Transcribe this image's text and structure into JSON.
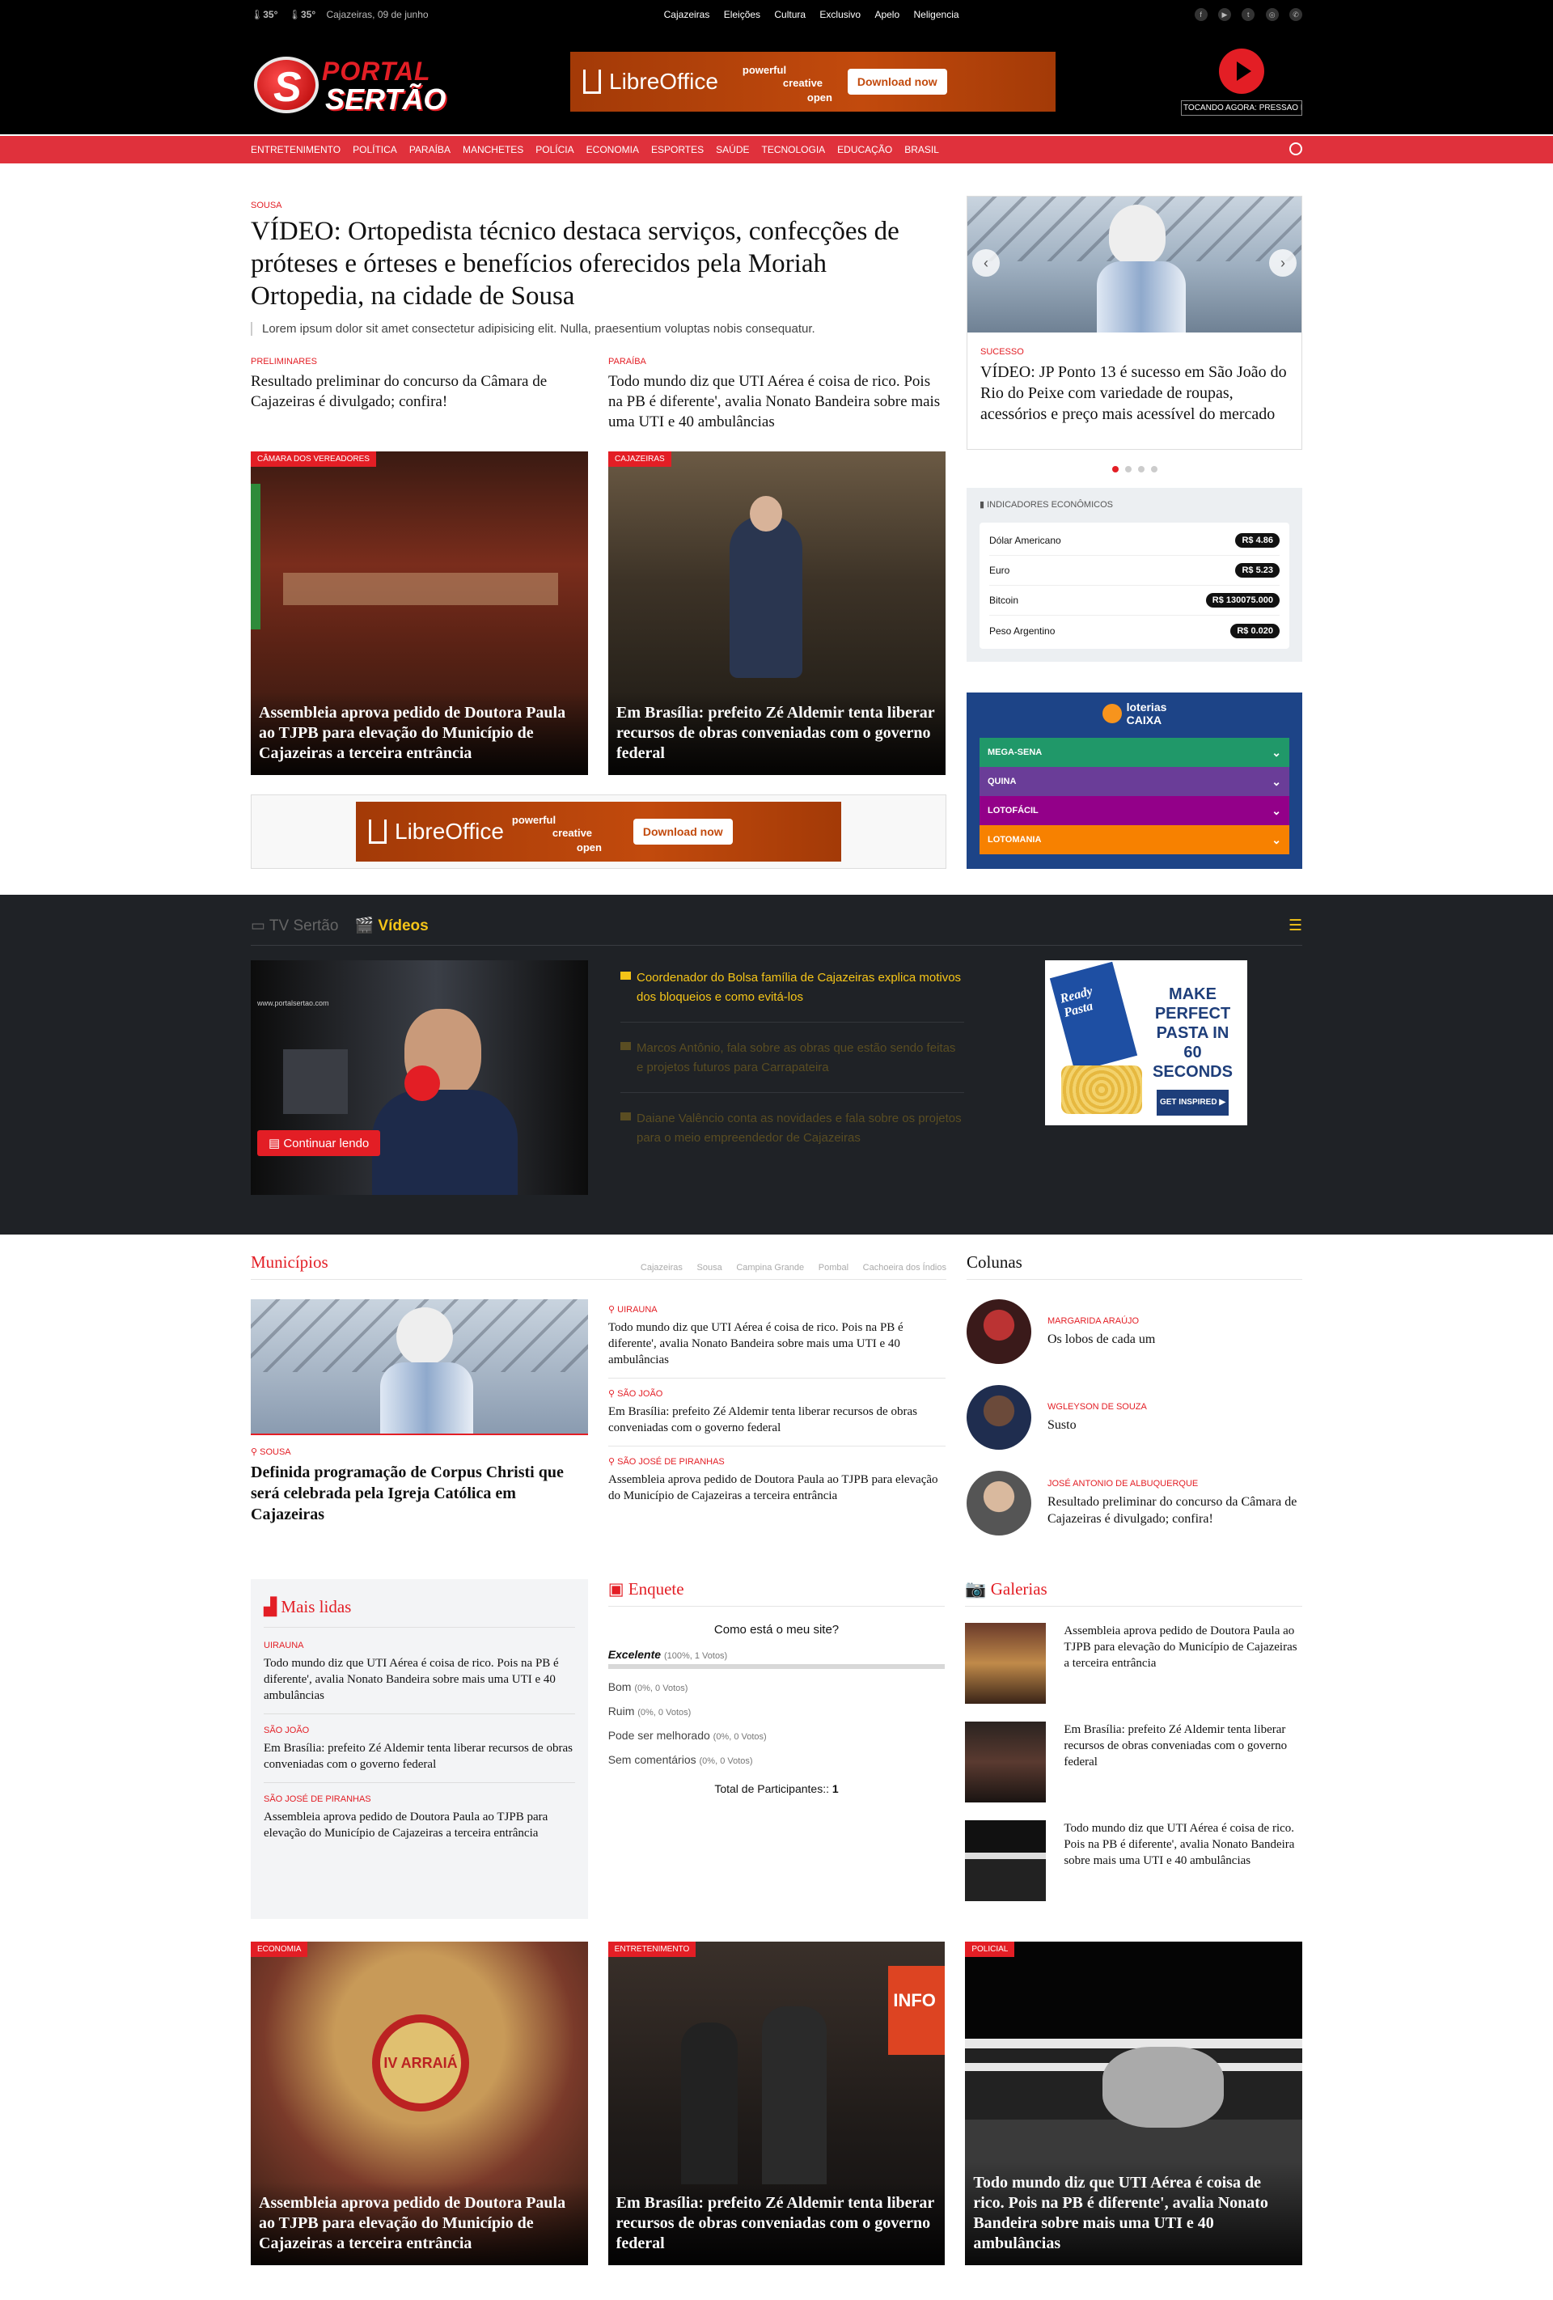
{
  "topbar": {
    "weather1": "35°",
    "weather2": "35°",
    "date": "Cajazeiras, 09 de junho",
    "links": [
      "Cajazeiras",
      "Eleições",
      "Cultura",
      "Exclusivo",
      "Apelo",
      "Neligencia"
    ],
    "social": [
      "facebook-icon",
      "youtube-icon",
      "twitter-icon",
      "instagram-icon",
      "whatsapp-icon"
    ]
  },
  "header": {
    "logo_top": "PORTAL",
    "logo_bottom": "SERTÃO",
    "ad": {
      "brand": "LibreOffice",
      "tag1": "powerful",
      "tag2": "creative",
      "tag3": "open",
      "cta": "Download now"
    },
    "player_now": "TOCANDO AGORA: PRESSAO FO"
  },
  "nav": [
    "ENTRETENIMENTO",
    "POLÍTICA",
    "PARAÍBA",
    "MANCHETES",
    "POLÍCIA",
    "ECONOMIA",
    "ESPORTES",
    "SAÚDE",
    "TECNOLOGIA",
    "EDUCAÇÃO",
    "BRASIL"
  ],
  "lead": {
    "cat": "SOUSA",
    "title": "VÍDEO: Ortopedista técnico destaca serviços, confecções de próteses e órteses e benefícios oferecidos pela Moriah Ortopedia, na cidade de Sousa",
    "excerpt": "Lorem ipsum dolor sit amet consectetur adipisicing elit. Nulla, praesentium voluptas nobis consequatur."
  },
  "sub": [
    {
      "cat": "PRELIMINARES",
      "title": "Resultado preliminar do concurso da Câmara de Cajazeiras é divulgado; confira!"
    },
    {
      "cat": "PARAÍBA",
      "title": "Todo mundo diz que UTI Aérea é coisa de rico. Pois na PB é diferente', avalia Nonato Bandeira sobre mais uma UTI e 40 ambulâncias"
    }
  ],
  "cards": [
    {
      "cat": "CÂMARA DOS VEREADORES",
      "title": "Assembleia aprova pedido de Doutora Paula ao TJPB para elevação do Município de Cajazeiras a terceira entrância"
    },
    {
      "cat": "CAJAZEIRAS",
      "title": "Em Brasília: prefeito Zé Aldemir tenta liberar recursos de obras conveniadas com o governo federal"
    }
  ],
  "slider": {
    "cat": "SUCESSO",
    "title": "VÍDEO: JP Ponto 13 é sucesso em São João do Rio do Peixe com variedade de roupas, acessórios e preço mais acessível do mercado"
  },
  "indicators": {
    "title": "INDICADORES ECONÔMICOS",
    "rows": [
      {
        "name": "Dólar Americano",
        "value": "R$ 4.86"
      },
      {
        "name": "Euro",
        "value": "R$ 5.23"
      },
      {
        "name": "Bitcoin",
        "value": "R$ 130075.000"
      },
      {
        "name": "Peso Argentino",
        "value": "R$ 0.020"
      }
    ]
  },
  "loterias": {
    "title1": "loterias",
    "title2": "CAIXA",
    "games": [
      {
        "name": "MEGA-SENA",
        "color": "#209869"
      },
      {
        "name": "QUINA",
        "color": "#6a3d98"
      },
      {
        "name": "LOTOFÁCIL",
        "color": "#930089"
      },
      {
        "name": "LOTOMANIA",
        "color": "#f78100"
      }
    ]
  },
  "tv": {
    "tab1": "TV Sertão",
    "tab2": "Vídeos",
    "watermark": "www.portalsertao.com",
    "button": "Continuar lendo",
    "items": [
      "Coordenador do Bolsa família de Cajazeiras explica motivos dos bloqueios e como evitá-los",
      "Marcos Antônio, fala sobre as obras que estão sendo feitas e projetos futuros para Carrapateira",
      "Daiane Valêncio conta as novidades e fala sobre os projetos para o meio empreendedor de Cajazeiras"
    ],
    "ad": {
      "line1": "MAKE",
      "line2": "PERFECT",
      "line3": "PASTA IN",
      "line4": "60 SECONDS",
      "cta": "GET INSPIRED ▶",
      "box": "Ready Pasta"
    }
  },
  "municipios": {
    "title": "Municípios",
    "tabs": [
      "Cajazeiras",
      "Sousa",
      "Campina Grande",
      "Pombal",
      "Cachoeira dos Índios"
    ],
    "big": {
      "cat": "SOUSA",
      "title": "Definida programação de Corpus Christi que será celebrada pela Igreja Católica em Cajazeiras"
    },
    "list": [
      {
        "cat": "UIRAUNA",
        "title": "Todo mundo diz que UTI Aérea é coisa de rico. Pois na PB é diferente', avalia Nonato Bandeira sobre mais uma UTI e 40 ambulâncias"
      },
      {
        "cat": "SÃO JOÃO",
        "title": "Em Brasília: prefeito Zé Aldemir tenta liberar recursos de obras conveniadas com o governo federal"
      },
      {
        "cat": "SÃO JOSÉ DE PIRANHAS",
        "title": "Assembleia aprova pedido de Doutora Paula ao TJPB para elevação do Município de Cajazeiras a terceira entrância"
      }
    ]
  },
  "colunas": {
    "title": "Colunas",
    "items": [
      {
        "author": "MARGARIDA ARAÚJO",
        "title": "Os lobos de cada um"
      },
      {
        "author": "WGLEYSON DE SOUZA",
        "title": "Susto"
      },
      {
        "author": "JOSÉ ANTONIO DE ALBUQUERQUE",
        "title": "Resultado preliminar do concurso da Câmara de Cajazeiras é divulgado; confira!"
      }
    ]
  },
  "mais_lidas": {
    "title": "Mais lidas",
    "items": [
      {
        "cat": "UIRAUNA",
        "title": "Todo mundo diz que UTI Aérea é coisa de rico. Pois na PB é diferente', avalia Nonato Bandeira sobre mais uma UTI e 40 ambulâncias"
      },
      {
        "cat": "SÃO JOÃO",
        "title": "Em Brasília: prefeito Zé Aldemir tenta liberar recursos de obras conveniadas com o governo federal"
      },
      {
        "cat": "SÃO JOSÉ DE PIRANHAS",
        "title": "Assembleia aprova pedido de Doutora Paula ao TJPB para elevação do Município de Cajazeiras a terceira entrância"
      }
    ]
  },
  "enquete": {
    "title": "Enquete",
    "question": "Como está o meu site?",
    "options": [
      {
        "label": "Excelente",
        "stat": "(100%, 1 Votos)",
        "pct": 1.0
      },
      {
        "label": "Bom",
        "stat": "(0%, 0 Votos)",
        "pct": 0
      },
      {
        "label": "Ruim",
        "stat": "(0%, 0 Votos)",
        "pct": 0
      },
      {
        "label": "Pode ser melhorado",
        "stat": "(0%, 0 Votos)",
        "pct": 0
      },
      {
        "label": "Sem comentários",
        "stat": "(0%, 0 Votos)",
        "pct": 0
      }
    ],
    "total_label": "Total de Participantes::",
    "total": "1"
  },
  "galerias": {
    "title": "Galerias",
    "items": [
      "Assembleia aprova pedido de Doutora Paula ao TJPB para elevação do Município de Cajazeiras a terceira entrância",
      "Em Brasília: prefeito Zé Aldemir tenta liberar recursos de obras conveniadas com o governo federal",
      "Todo mundo diz que UTI Aérea é coisa de rico. Pois na PB é diferente', avalia Nonato Bandeira sobre mais uma UTI e 40 ambulâncias"
    ]
  },
  "bottom": [
    {
      "cat": "ECONOMIA",
      "title": "Assembleia aprova pedido de Doutora Paula ao TJPB para elevação do Município de Cajazeiras a terceira entrância",
      "sign": "IV ARRAIÁ"
    },
    {
      "cat": "ENTRETENIMENTO",
      "title": "Em Brasília: prefeito Zé Aldemir tenta liberar recursos de obras conveniadas com o governo federal",
      "sign": "INFO"
    },
    {
      "cat": "POLICIAL",
      "title": "Todo mundo diz que UTI Aérea é coisa de rico. Pois na PB é diferente', avalia Nonato Bandeira sobre mais uma UTI e 40 ambulâncias"
    }
  ]
}
